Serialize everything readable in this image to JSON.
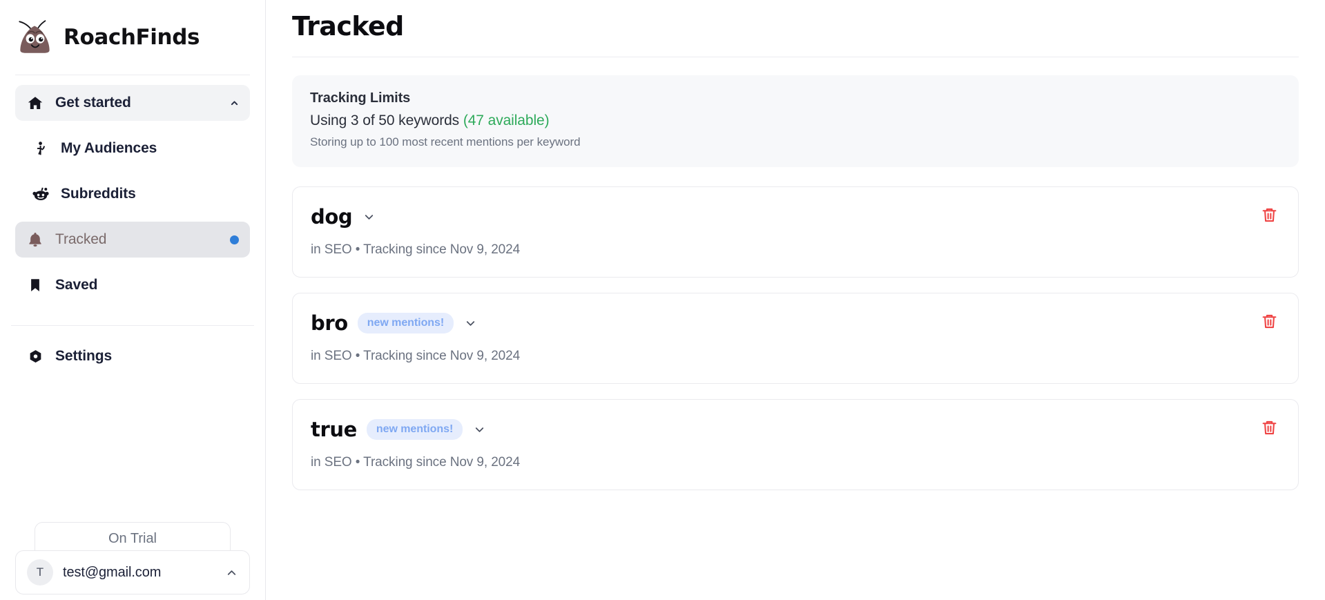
{
  "brand": {
    "name": "RoachFinds",
    "logo_icon": "roach-mascot-logo"
  },
  "sidebar": {
    "items": [
      {
        "label": "Get started",
        "icon": "home-icon",
        "state": "active-grey",
        "trailing": "chevron-up-icon"
      },
      {
        "label": "My Audiences",
        "icon": "person-wave-icon",
        "state": "sub",
        "trailing": ""
      },
      {
        "label": "Subreddits",
        "icon": "reddit-icon",
        "state": "sub",
        "trailing": ""
      },
      {
        "label": "Tracked",
        "icon": "bell-icon",
        "state": "active-dark",
        "trailing": "blue-dot"
      },
      {
        "label": "Saved",
        "icon": "bookmark-icon",
        "state": "",
        "trailing": ""
      },
      {
        "label": "Settings",
        "icon": "gear-icon",
        "state": "",
        "trailing": ""
      }
    ],
    "footer": {
      "trial_label": "On Trial",
      "avatar_initial": "T",
      "email": "test@gmail.com",
      "chevron_icon": "chevron-up-icon"
    }
  },
  "main": {
    "page_title": "Tracked",
    "limits": {
      "title": "Tracking Limits",
      "usage_prefix": "Using 3 of 50 keywords",
      "available": "(47 available)",
      "note": "Storing up to 100 most recent mentions per keyword"
    },
    "keywords": [
      {
        "name": "dog",
        "badge": "",
        "meta": "in SEO • Tracking since Nov 9, 2024",
        "chevron_icon": "chevron-down-icon",
        "delete_icon": "trash-icon"
      },
      {
        "name": "bro",
        "badge": "new mentions!",
        "meta": "in SEO • Tracking since Nov 9, 2024",
        "chevron_icon": "chevron-down-icon",
        "delete_icon": "trash-icon"
      },
      {
        "name": "true",
        "badge": "new mentions!",
        "meta": "in SEO • Tracking since Nov 9, 2024",
        "chevron_icon": "chevron-down-icon",
        "delete_icon": "trash-icon"
      }
    ]
  },
  "colors": {
    "accent_blue": "#2f7ed8",
    "badge_bg": "#e6edfd",
    "badge_text": "#7fa8f2",
    "available_green": "#2eaa5a",
    "delete_red": "#ef4444",
    "roach_body": "#7a5c5c",
    "active_nav_bg": "#e4e5e9",
    "tracked_label": "#7a6a6a"
  }
}
